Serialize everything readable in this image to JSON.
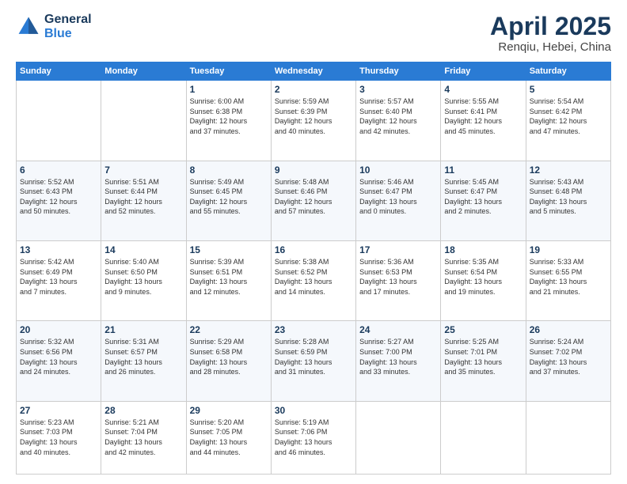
{
  "header": {
    "logo_general": "General",
    "logo_blue": "Blue",
    "title": "April 2025",
    "location": "Renqiu, Hebei, China"
  },
  "weekdays": [
    "Sunday",
    "Monday",
    "Tuesday",
    "Wednesday",
    "Thursday",
    "Friday",
    "Saturday"
  ],
  "weeks": [
    [
      {
        "day": "",
        "info": ""
      },
      {
        "day": "",
        "info": ""
      },
      {
        "day": "1",
        "info": "Sunrise: 6:00 AM\nSunset: 6:38 PM\nDaylight: 12 hours\nand 37 minutes."
      },
      {
        "day": "2",
        "info": "Sunrise: 5:59 AM\nSunset: 6:39 PM\nDaylight: 12 hours\nand 40 minutes."
      },
      {
        "day": "3",
        "info": "Sunrise: 5:57 AM\nSunset: 6:40 PM\nDaylight: 12 hours\nand 42 minutes."
      },
      {
        "day": "4",
        "info": "Sunrise: 5:55 AM\nSunset: 6:41 PM\nDaylight: 12 hours\nand 45 minutes."
      },
      {
        "day": "5",
        "info": "Sunrise: 5:54 AM\nSunset: 6:42 PM\nDaylight: 12 hours\nand 47 minutes."
      }
    ],
    [
      {
        "day": "6",
        "info": "Sunrise: 5:52 AM\nSunset: 6:43 PM\nDaylight: 12 hours\nand 50 minutes."
      },
      {
        "day": "7",
        "info": "Sunrise: 5:51 AM\nSunset: 6:44 PM\nDaylight: 12 hours\nand 52 minutes."
      },
      {
        "day": "8",
        "info": "Sunrise: 5:49 AM\nSunset: 6:45 PM\nDaylight: 12 hours\nand 55 minutes."
      },
      {
        "day": "9",
        "info": "Sunrise: 5:48 AM\nSunset: 6:46 PM\nDaylight: 12 hours\nand 57 minutes."
      },
      {
        "day": "10",
        "info": "Sunrise: 5:46 AM\nSunset: 6:47 PM\nDaylight: 13 hours\nand 0 minutes."
      },
      {
        "day": "11",
        "info": "Sunrise: 5:45 AM\nSunset: 6:47 PM\nDaylight: 13 hours\nand 2 minutes."
      },
      {
        "day": "12",
        "info": "Sunrise: 5:43 AM\nSunset: 6:48 PM\nDaylight: 13 hours\nand 5 minutes."
      }
    ],
    [
      {
        "day": "13",
        "info": "Sunrise: 5:42 AM\nSunset: 6:49 PM\nDaylight: 13 hours\nand 7 minutes."
      },
      {
        "day": "14",
        "info": "Sunrise: 5:40 AM\nSunset: 6:50 PM\nDaylight: 13 hours\nand 9 minutes."
      },
      {
        "day": "15",
        "info": "Sunrise: 5:39 AM\nSunset: 6:51 PM\nDaylight: 13 hours\nand 12 minutes."
      },
      {
        "day": "16",
        "info": "Sunrise: 5:38 AM\nSunset: 6:52 PM\nDaylight: 13 hours\nand 14 minutes."
      },
      {
        "day": "17",
        "info": "Sunrise: 5:36 AM\nSunset: 6:53 PM\nDaylight: 13 hours\nand 17 minutes."
      },
      {
        "day": "18",
        "info": "Sunrise: 5:35 AM\nSunset: 6:54 PM\nDaylight: 13 hours\nand 19 minutes."
      },
      {
        "day": "19",
        "info": "Sunrise: 5:33 AM\nSunset: 6:55 PM\nDaylight: 13 hours\nand 21 minutes."
      }
    ],
    [
      {
        "day": "20",
        "info": "Sunrise: 5:32 AM\nSunset: 6:56 PM\nDaylight: 13 hours\nand 24 minutes."
      },
      {
        "day": "21",
        "info": "Sunrise: 5:31 AM\nSunset: 6:57 PM\nDaylight: 13 hours\nand 26 minutes."
      },
      {
        "day": "22",
        "info": "Sunrise: 5:29 AM\nSunset: 6:58 PM\nDaylight: 13 hours\nand 28 minutes."
      },
      {
        "day": "23",
        "info": "Sunrise: 5:28 AM\nSunset: 6:59 PM\nDaylight: 13 hours\nand 31 minutes."
      },
      {
        "day": "24",
        "info": "Sunrise: 5:27 AM\nSunset: 7:00 PM\nDaylight: 13 hours\nand 33 minutes."
      },
      {
        "day": "25",
        "info": "Sunrise: 5:25 AM\nSunset: 7:01 PM\nDaylight: 13 hours\nand 35 minutes."
      },
      {
        "day": "26",
        "info": "Sunrise: 5:24 AM\nSunset: 7:02 PM\nDaylight: 13 hours\nand 37 minutes."
      }
    ],
    [
      {
        "day": "27",
        "info": "Sunrise: 5:23 AM\nSunset: 7:03 PM\nDaylight: 13 hours\nand 40 minutes."
      },
      {
        "day": "28",
        "info": "Sunrise: 5:21 AM\nSunset: 7:04 PM\nDaylight: 13 hours\nand 42 minutes."
      },
      {
        "day": "29",
        "info": "Sunrise: 5:20 AM\nSunset: 7:05 PM\nDaylight: 13 hours\nand 44 minutes."
      },
      {
        "day": "30",
        "info": "Sunrise: 5:19 AM\nSunset: 7:06 PM\nDaylight: 13 hours\nand 46 minutes."
      },
      {
        "day": "",
        "info": ""
      },
      {
        "day": "",
        "info": ""
      },
      {
        "day": "",
        "info": ""
      }
    ]
  ]
}
